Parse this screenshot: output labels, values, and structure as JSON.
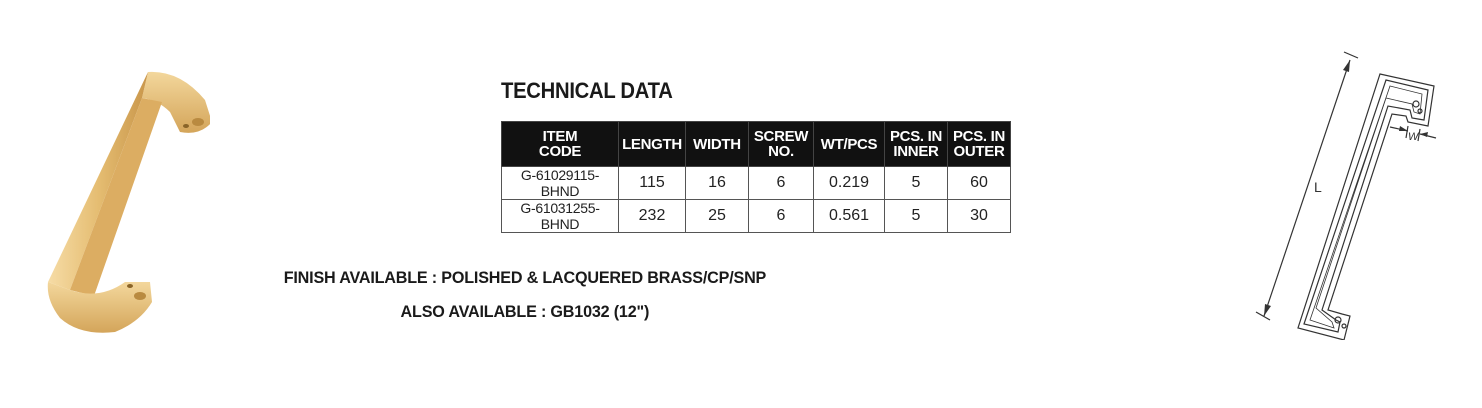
{
  "heading": "TECHNICAL DATA",
  "table": {
    "headers": [
      [
        "ITEM",
        "CODE"
      ],
      [
        "LENGTH"
      ],
      [
        "WIDTH"
      ],
      [
        "SCREW",
        "NO."
      ],
      [
        "WT/PCS"
      ],
      [
        "PCS. IN",
        "INNER"
      ],
      [
        "PCS. IN",
        "OUTER"
      ]
    ],
    "rows": [
      [
        "G-61029115-BHND",
        "115",
        "16",
        "6",
        "0.219",
        "5",
        "60"
      ],
      [
        "G-61031255-BHND",
        "232",
        "25",
        "6",
        "0.561",
        "5",
        "30"
      ]
    ]
  },
  "finish_line": "FINISH AVAILABLE : POLISHED & LACQUERED BRASS/CP/SNP",
  "also_line": "ALSO AVAILABLE : GB1032 (12\")",
  "drawing": {
    "length_label": "L",
    "width_label": "W"
  },
  "colors": {
    "brass": "#e8c27a",
    "header_bg": "#111111",
    "text": "#1a1a1a"
  }
}
